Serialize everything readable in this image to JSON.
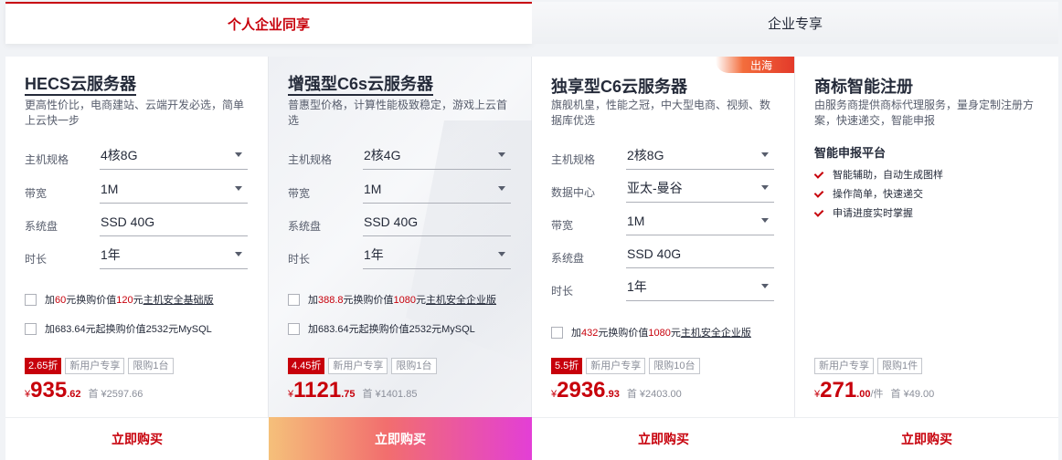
{
  "tabs": [
    {
      "label": "个人企业同享",
      "active": true
    },
    {
      "label": "企业专享",
      "active": false
    }
  ],
  "cards": [
    {
      "title": "HECS云服务器",
      "desc": "更高性价比，电商建站、云端开发必选，简单上云快一步",
      "specs": [
        {
          "label": "主机规格",
          "value": "4核8G",
          "dropdown": true
        },
        {
          "label": "带宽",
          "value": "1M",
          "dropdown": true
        },
        {
          "label": "系统盘",
          "value": "SSD 40G",
          "dropdown": false
        },
        {
          "label": "时长",
          "value": "1年",
          "dropdown": true
        }
      ],
      "addons": [
        {
          "pre": "加",
          "red1": "60",
          "mid": "元换购价值",
          "red2": "120",
          "post": "元",
          "link": "主机安全基础版"
        },
        {
          "text": "加683.64元起换购价值2532元MySQL"
        }
      ],
      "discount": "2.65折",
      "tags": [
        "新用户专享",
        "限购1台"
      ],
      "price": {
        "yen": "¥",
        "int": "935",
        "dec": ".62",
        "unit": "",
        "orig": "首 ¥2597.66"
      },
      "buy": "立即购买"
    },
    {
      "title": "增强型C6s云服务器",
      "desc": "普惠型价格，计算性能极致稳定，游戏上云首选",
      "specs": [
        {
          "label": "主机规格",
          "value": "2核4G",
          "dropdown": true
        },
        {
          "label": "带宽",
          "value": "1M",
          "dropdown": true
        },
        {
          "label": "系统盘",
          "value": "SSD 40G",
          "dropdown": false
        },
        {
          "label": "时长",
          "value": "1年",
          "dropdown": true
        }
      ],
      "addons": [
        {
          "pre": "加",
          "red1": "388.8",
          "mid": "元换购价值",
          "red2": "1080",
          "post": "元",
          "link": "主机安全企业版"
        },
        {
          "text": "加683.64元起换购价值2532元MySQL"
        }
      ],
      "discount": "4.45折",
      "tags": [
        "新用户专享",
        "限购1台"
      ],
      "price": {
        "yen": "¥",
        "int": "1121",
        "dec": ".75",
        "unit": "",
        "orig": "首 ¥1401.85"
      },
      "buy": "立即购买"
    },
    {
      "title": "独享型C6云服务器",
      "badge": "出海",
      "desc": "旗舰机皇，性能之冠，中大型电商、视频、数据库优选",
      "specs": [
        {
          "label": "主机规格",
          "value": "2核8G",
          "dropdown": true
        },
        {
          "label": "数据中心",
          "value": "亚太-曼谷",
          "dropdown": true
        },
        {
          "label": "带宽",
          "value": "1M",
          "dropdown": true
        },
        {
          "label": "系统盘",
          "value": "SSD 40G",
          "dropdown": false
        },
        {
          "label": "时长",
          "value": "1年",
          "dropdown": true
        }
      ],
      "addons": [
        {
          "pre": "加",
          "red1": "432",
          "mid": "元换购价值",
          "red2": "1080",
          "post": "元",
          "link": "主机安全企业版"
        }
      ],
      "discount": "5.5折",
      "tags": [
        "新用户专享",
        "限购10台"
      ],
      "price": {
        "yen": "¥",
        "int": "2936",
        "dec": ".93",
        "unit": "",
        "orig": "首 ¥2403.00"
      },
      "buy": "立即购买"
    },
    {
      "title": "商标智能注册",
      "desc": "由服务商提供商标代理服务，量身定制注册方案，快速递交，智能申报",
      "subtitle": "智能申报平台",
      "features": [
        "智能辅助，自动生成图样",
        "操作简单，快速递交",
        "申请进度实时掌握"
      ],
      "tags": [
        "新用户专享",
        "限购1件"
      ],
      "price": {
        "yen": "¥",
        "int": "271",
        "dec": ".00",
        "unit": "/件",
        "orig": "首 ¥49.00"
      },
      "buy": "立即购买"
    }
  ],
  "colors": {
    "brand": "#c7000b",
    "text": "#252b3a",
    "muted": "#8a8e99"
  }
}
